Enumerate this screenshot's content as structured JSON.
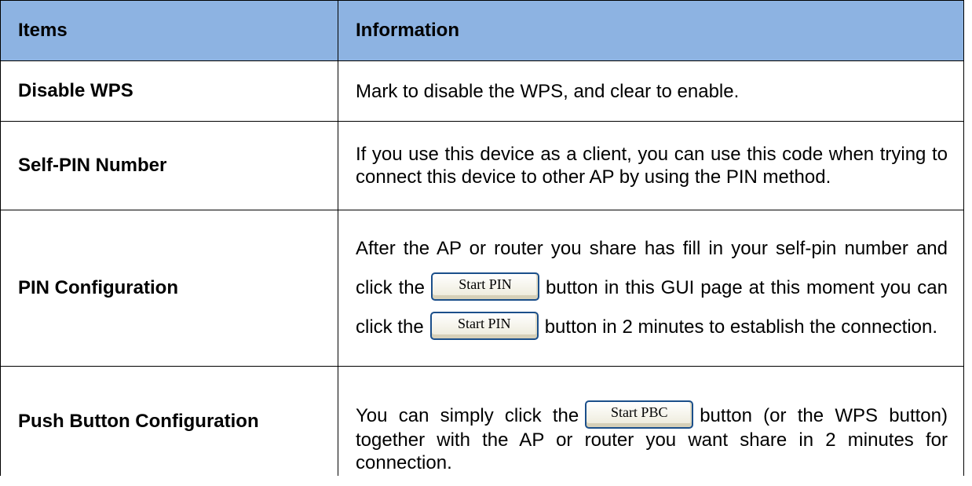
{
  "table": {
    "headers": {
      "items": "Items",
      "information": "Information"
    },
    "rows": [
      {
        "item": "Disable WPS",
        "info": "Mark to disable the WPS, and clear to enable."
      },
      {
        "item": "Self-PIN Number",
        "info": "If you use this device as a client, you can use this code when trying to connect this device to other AP by using the PIN method."
      },
      {
        "item": "PIN Configuration",
        "info_parts": [
          "After the AP or router you share has fill in your self-pin number and click the",
          "button in this GUI page at this moment you can click the",
          "button in 2 minutes to establish the connection."
        ],
        "button_label": "Start PIN"
      },
      {
        "item": "Push Button Configuration",
        "info_parts": [
          "You can simply click the",
          "button (or the WPS button) together with the AP or router you want share in 2 minutes for connection."
        ],
        "button_label": "Start PBC"
      }
    ]
  }
}
